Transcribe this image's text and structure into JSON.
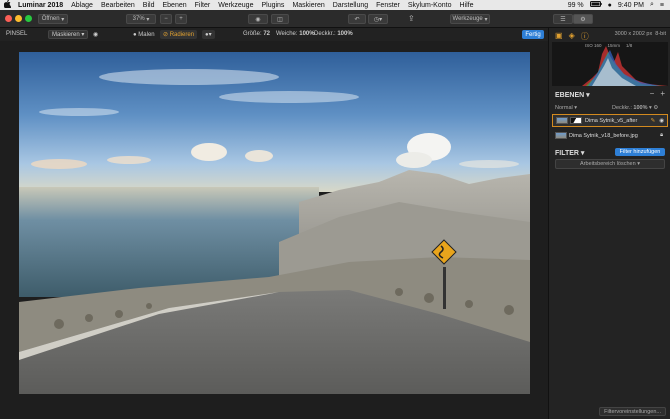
{
  "menubar": {
    "apple": "",
    "app": "Luminar 2018",
    "items": [
      "Ablage",
      "Bearbeiten",
      "Bild",
      "Ebenen",
      "Filter",
      "Werkzeuge",
      "Plugins",
      "Maskieren",
      "Darstellung",
      "Fenster",
      "Skylum-Konto",
      "Hilfe"
    ],
    "battery": "99 %",
    "clock": "9:40 PM"
  },
  "toolbar": {
    "open_label": "Öffnen",
    "zoom_label": "37%",
    "minus": "−",
    "plus": "+",
    "tools_label": "Werkzeuge"
  },
  "optbar": {
    "tool": "PINSEL",
    "mask_label": "Maskieren",
    "paint_label": "Malen",
    "erase_label": "Radieren",
    "size_label": "Größe:",
    "size_value": "72",
    "soft_label": "Weiche:",
    "soft_value": "100%",
    "opacity_label": "Deckkr.:",
    "opacity_value": "100%",
    "done_label": "Fertig"
  },
  "panel": {
    "image_size": "3000 x 2002 px",
    "bit_depth": "8-bit",
    "histo_labels": [
      "ISO 160",
      "15mm",
      "1/8"
    ],
    "layers_title": "EBENEN",
    "blend_mode": "Normal",
    "opacity_label": "Deckkr.:",
    "opacity_value": "100%",
    "layers": [
      {
        "name": "Dima Sytnik_v5_after",
        "active": true
      },
      {
        "name": "Dima Sytnik_v18_before.jpg",
        "active": false
      }
    ],
    "filter_title": "FILTER",
    "add_filter_label": "Filter hinzufügen",
    "workspace_label": "Arbeitsbereich löschen",
    "presets_label": "Filtervoreinstellungen..."
  },
  "colors": {
    "accent": "#2e7fd6",
    "orange": "#d38a1f",
    "close": "#fc5f57",
    "minimize": "#fdbc2e",
    "zoom": "#28c840"
  }
}
